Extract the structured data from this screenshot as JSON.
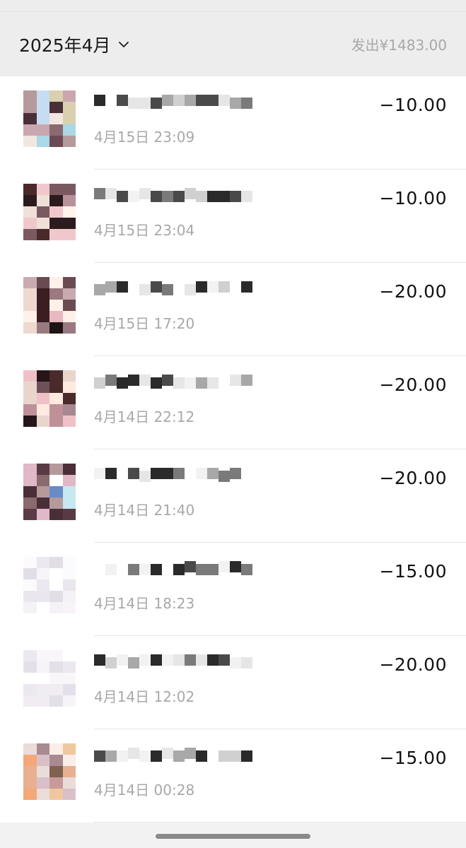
{
  "header": {
    "month_label": "2025年4月",
    "summary": "发出¥1483.00"
  },
  "transactions": [
    {
      "time": "4月15日 23:09",
      "amount": "−10.00"
    },
    {
      "time": "4月15日 23:04",
      "amount": "−10.00"
    },
    {
      "time": "4月15日 17:20",
      "amount": "−20.00"
    },
    {
      "time": "4月14日 22:12",
      "amount": "−20.00"
    },
    {
      "time": "4月14日 21:40",
      "amount": "−20.00"
    },
    {
      "time": "4月14日 18:23",
      "amount": "−15.00"
    },
    {
      "time": "4月14日 12:02",
      "amount": "−20.00"
    },
    {
      "time": "4月14日 00:28",
      "amount": "−15.00"
    }
  ],
  "icons": {
    "chevron": "chevron-down-icon"
  },
  "colors": {
    "header_bg": "#ededed",
    "muted_text": "#a8a8a8",
    "primary_text": "#111111"
  }
}
